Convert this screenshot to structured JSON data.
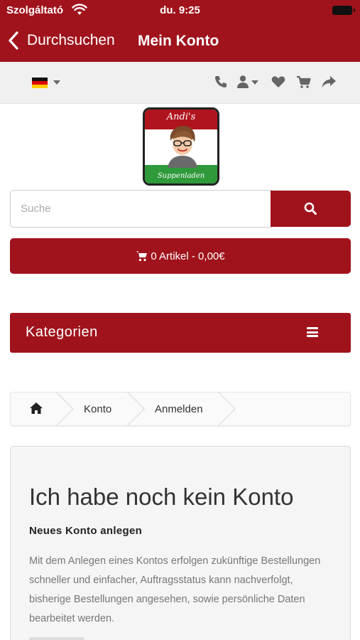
{
  "status_bar": {
    "carrier": "Szolgáltató",
    "time": "du. 9:25"
  },
  "nav": {
    "back_label": "Durchsuchen",
    "title": "Mein Konto"
  },
  "toolbar": {
    "language_flag": "germany-flag",
    "icons": [
      "phone-icon",
      "user-icon",
      "heart-icon",
      "cart-icon",
      "share-icon"
    ]
  },
  "logo": {
    "name": "Andi's",
    "subtitle": "Suppenladen"
  },
  "search": {
    "placeholder": "Suche",
    "value": ""
  },
  "cart": {
    "label": "0 Artikel - 0,00€"
  },
  "categories": {
    "label": "Kategorien"
  },
  "breadcrumb": {
    "items": [
      "Konto",
      "Anmelden"
    ]
  },
  "panel": {
    "heading": "Ich habe noch kein Konto",
    "subheading": "Neues Konto anlegen",
    "text": "Mit dem Anlegen eines Kontos erfolgen zukünftige Bestellungen schneller und einfacher, Auftragsstatus kann nachverfolgt, bisherige Bestellungen angesehen, sowie persönliche Daten bearbeitet werden."
  },
  "colors": {
    "brand": "#a0131c",
    "toolbar_bg": "#f0f0f0",
    "panel_bg": "#f5f5f5"
  }
}
